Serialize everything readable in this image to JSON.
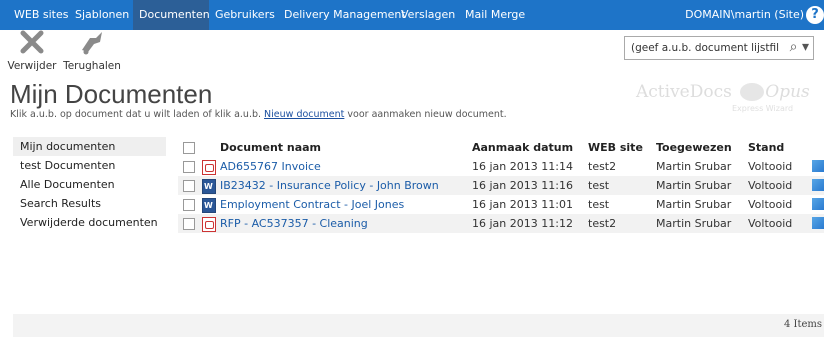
{
  "topnav": {
    "tabs": [
      {
        "label": "WEB sites",
        "active": false
      },
      {
        "label": "Sjablonen",
        "active": false
      },
      {
        "label": "Documenten",
        "active": true
      },
      {
        "label": "Gebruikers",
        "active": false
      },
      {
        "label": "Delivery Management",
        "active": false
      },
      {
        "label": "Verslagen",
        "active": false
      },
      {
        "label": "Mail Merge",
        "active": false
      }
    ],
    "user": "DOMAIN\\martin (Site)",
    "help_icon": "?",
    "colors": {
      "bar": "#1e74c8",
      "active": "#2c5f97"
    }
  },
  "ribbon": {
    "delete_label": "Verwijder",
    "restore_label": "Terughalen"
  },
  "filter": {
    "value": "(geef a.u.b. document lijstfilter)",
    "icon": "⌕ ▾"
  },
  "page": {
    "title": "Mijn Documenten",
    "subtitle_before": "Klik a.u.b. op document dat u wilt laden of klik a.u.b. ",
    "subtitle_link": "Nieuw document",
    "subtitle_after": " voor aanmaken nieuw document."
  },
  "brand": {
    "name": "ActiveDocs",
    "tag": "Opus",
    "sub": "Express Wizard"
  },
  "leftnav": {
    "items": [
      {
        "label": "Mijn documenten",
        "active": true
      },
      {
        "label": "test Documenten",
        "active": false
      },
      {
        "label": "Alle Documenten",
        "active": false
      },
      {
        "label": "Search Results",
        "active": false
      },
      {
        "label": "Verwijderde documenten",
        "active": false
      }
    ]
  },
  "table": {
    "headers": {
      "name": "Document naam",
      "date": "Aanmaak datum",
      "site": "WEB site",
      "assigned": "Toegewezen",
      "status": "Stand"
    },
    "rows": [
      {
        "type": "pdf-icon",
        "name": "AD655767 Invoice",
        "date": "16 jan 2013 11:14",
        "site": "test2",
        "assigned": "Martin Srubar",
        "status": "Voltooid"
      },
      {
        "type": "word-icon",
        "name": "IB23432 - Insurance Policy - John Brown",
        "date": "16 jan 2013 11:16",
        "site": "test",
        "assigned": "Martin Srubar",
        "status": "Voltooid"
      },
      {
        "type": "word-icon",
        "name": "Employment Contract - Joel Jones",
        "date": "16 jan 2013 11:01",
        "site": "test",
        "assigned": "Martin Srubar",
        "status": "Voltooid"
      },
      {
        "type": "pdf-icon",
        "name": "RFP - AC537357 - Cleaning",
        "date": "16 jan 2013 11:12",
        "site": "test2",
        "assigned": "Martin Srubar",
        "status": "Voltooid"
      }
    ]
  },
  "footer": {
    "count": "4 Items"
  }
}
